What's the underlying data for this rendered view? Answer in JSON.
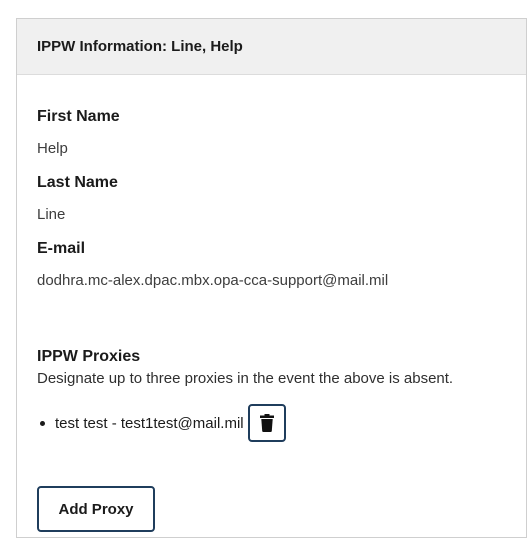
{
  "header": {
    "title": "IPPW Information: Line, Help"
  },
  "fields": {
    "first_name": {
      "label": "First Name",
      "value": "Help"
    },
    "last_name": {
      "label": "Last Name",
      "value": "Line"
    },
    "email": {
      "label": "E-mail",
      "value": "dodhra.mc-alex.dpac.mbx.opa-cca-support@mail.mil"
    }
  },
  "proxies": {
    "title": "IPPW Proxies",
    "description": "Designate up to three proxies in the event the above is absent.",
    "items": [
      {
        "text": "test test - test1test@mail.mil",
        "delete_icon": "trash-icon"
      }
    ],
    "add_button_label": "Add Proxy"
  },
  "colors": {
    "header_bg": "#f0f0f0",
    "button_border": "#1f3d5c"
  }
}
